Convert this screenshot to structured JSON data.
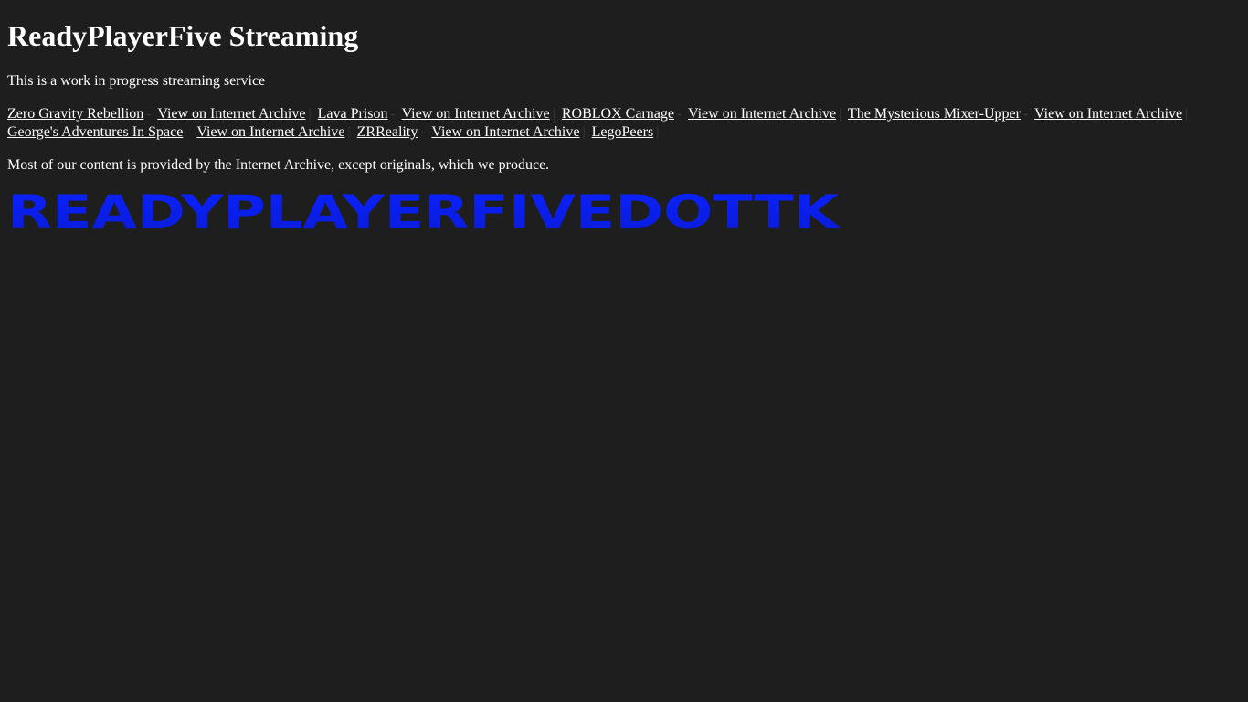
{
  "page": {
    "title": "ReadyPlayerFive Streaming",
    "subtitle": "This is a work in progress streaming service",
    "footer_note": "Most of our content is provided by the Internet Archive, except originals, which we produce."
  },
  "links": [
    {
      "label": "Zero Gravity Rebellion",
      "sep": "-"
    },
    {
      "label": "View on Internet Archive",
      "sep": "|"
    },
    {
      "label": "Lava Prison",
      "sep": "-"
    },
    {
      "label": "View on Internet Archive",
      "sep": "|"
    },
    {
      "label": "ROBLOX Carnage",
      "sep": "-"
    },
    {
      "label": "View on Internet Archive",
      "sep": "|"
    },
    {
      "label": "The Mysterious Mixer-Upper",
      "sep": "-"
    },
    {
      "label": "View on Internet Archive",
      "sep": "|"
    },
    {
      "label": "George's Adventures In Space",
      "sep": "-"
    },
    {
      "label": "View on Internet Archive",
      "sep": "|"
    },
    {
      "label": "ZRReality",
      "sep": "-"
    },
    {
      "label": "View on Internet Archive",
      "sep": "|"
    },
    {
      "label": "LegoPeers",
      "sep": "|"
    }
  ],
  "logo": {
    "text": "READYPLAYERFIVEDOTTK",
    "color": "#0b22ff"
  }
}
